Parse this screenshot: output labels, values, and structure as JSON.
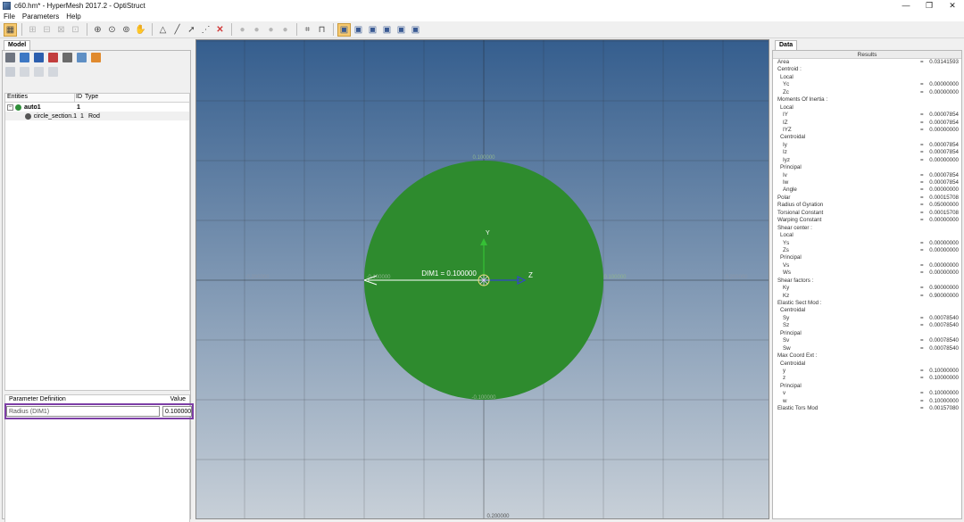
{
  "window": {
    "title": "c60.hm* - HyperMesh 2017.2 - OptiStruct",
    "controls": {
      "minimize": "—",
      "restore": "❐",
      "close": "✕"
    }
  },
  "menu": {
    "items": [
      "File",
      "Parameters",
      "Help"
    ]
  },
  "toolbar": {
    "groups": [
      [
        "grid-icon"
      ],
      [
        "node-add-icon",
        "line-icon",
        "surface-icon",
        "solid-icon"
      ],
      [
        "zoom-in-icon",
        "zoom-window-icon",
        "zoom-fit-icon",
        "pan-icon"
      ],
      [
        "polyline-icon",
        "line-draw-icon",
        "select-arrow-icon",
        "point-icon",
        "delete-icon"
      ],
      [
        "circle-1-icon",
        "circle-2-icon",
        "circle-3-icon",
        "circle-4-icon"
      ],
      [
        "hatch-icon",
        "section-icon"
      ],
      [
        "view-1-icon",
        "view-2-icon",
        "view-3-icon",
        "view-4-icon",
        "view-5-icon",
        "view-6-icon"
      ]
    ]
  },
  "left_panel": {
    "tab": "Model",
    "entities": {
      "headers": [
        "Entities",
        "ID",
        "Type"
      ],
      "rows": [
        {
          "name": "auto1",
          "id": "1",
          "type": ""
        },
        {
          "name": "circle_section.1",
          "id": "1",
          "type": "Rod"
        }
      ]
    },
    "parameters": {
      "header_label": "Parameter Definition",
      "header_value": "Value",
      "label": "Radius (DIM1)",
      "value": "0.100000"
    }
  },
  "viewport": {
    "colors": {
      "bg_top": "#355e8e",
      "bg_bottom": "#c8d0d8",
      "circle": "#2e8b2e",
      "axis": "#35c035",
      "z_axis": "#3344cc"
    },
    "tick_labels": {
      "top": "0.100000",
      "bottom_inner": "-0.100000",
      "left_outer": "-0.200000",
      "left_inner": "-0.100000",
      "right_inner": "0.100000",
      "right_outer": "0.200000",
      "bottom_outer": "0.200000"
    },
    "dim_label": "DIM1 = 0.100000",
    "y_label": "Y",
    "z_label": "Z"
  },
  "right_panel": {
    "tab": "Data",
    "results_title": "Results",
    "rows": [
      {
        "label": "Area",
        "indent": 0,
        "value": "0.03141593"
      },
      {
        "label": "Centroid :",
        "indent": 0,
        "value": ""
      },
      {
        "label": "Local",
        "indent": 1,
        "value": ""
      },
      {
        "label": "Yc",
        "indent": 2,
        "value": "0.00000000"
      },
      {
        "label": "Zc",
        "indent": 2,
        "value": "0.00000000"
      },
      {
        "label": "Moments Of Inertia :",
        "indent": 0,
        "value": ""
      },
      {
        "label": "Local",
        "indent": 1,
        "value": ""
      },
      {
        "label": "IY",
        "indent": 2,
        "value": "0.00007854"
      },
      {
        "label": "IZ",
        "indent": 2,
        "value": "0.00007854"
      },
      {
        "label": "IYZ",
        "indent": 2,
        "value": "0.00000000"
      },
      {
        "label": "Centroidal",
        "indent": 1,
        "value": ""
      },
      {
        "label": "Iy",
        "indent": 2,
        "value": "0.00007854"
      },
      {
        "label": "Iz",
        "indent": 2,
        "value": "0.00007854"
      },
      {
        "label": "Iyz",
        "indent": 2,
        "value": "0.00000000"
      },
      {
        "label": "Principal",
        "indent": 1,
        "value": ""
      },
      {
        "label": "Iv",
        "indent": 2,
        "value": "0.00007854"
      },
      {
        "label": "Iw",
        "indent": 2,
        "value": "0.00007854"
      },
      {
        "label": "Angle",
        "indent": 2,
        "value": "0.00000000"
      },
      {
        "label": "Polar",
        "indent": 0,
        "value": "0.00015708"
      },
      {
        "label": "Radius of Gyration",
        "indent": 0,
        "value": "0.05000000"
      },
      {
        "label": "Torsional Constant",
        "indent": 0,
        "value": "0.00015708"
      },
      {
        "label": "Warping Constant",
        "indent": 0,
        "value": "0.00000000"
      },
      {
        "label": "Shear center :",
        "indent": 0,
        "value": ""
      },
      {
        "label": "Local",
        "indent": 1,
        "value": ""
      },
      {
        "label": "Ys",
        "indent": 2,
        "value": "0.00000000"
      },
      {
        "label": "Zs",
        "indent": 2,
        "value": "0.00000000"
      },
      {
        "label": "Principal",
        "indent": 1,
        "value": ""
      },
      {
        "label": "Vs",
        "indent": 2,
        "value": "0.00000000"
      },
      {
        "label": "Ws",
        "indent": 2,
        "value": "0.00000000"
      },
      {
        "label": "Shear factors :",
        "indent": 0,
        "value": ""
      },
      {
        "label": "Ky",
        "indent": 2,
        "value": "0.90000000"
      },
      {
        "label": "Kz",
        "indent": 2,
        "value": "0.90000000"
      },
      {
        "label": "Elastic Sect Mod :",
        "indent": 0,
        "value": ""
      },
      {
        "label": "Centroidal",
        "indent": 1,
        "value": ""
      },
      {
        "label": "Sy",
        "indent": 2,
        "value": "0.00078540"
      },
      {
        "label": "Sz",
        "indent": 2,
        "value": "0.00078540"
      },
      {
        "label": "Principal",
        "indent": 1,
        "value": ""
      },
      {
        "label": "Sv",
        "indent": 2,
        "value": "0.00078540"
      },
      {
        "label": "Sw",
        "indent": 2,
        "value": "0.00078540"
      },
      {
        "label": "Max Coord Ext :",
        "indent": 0,
        "value": ""
      },
      {
        "label": "Centroidal",
        "indent": 1,
        "value": ""
      },
      {
        "label": "y",
        "indent": 2,
        "value": "0.10000000"
      },
      {
        "label": "z",
        "indent": 2,
        "value": "0.10000000"
      },
      {
        "label": "Principal",
        "indent": 1,
        "value": ""
      },
      {
        "label": "v",
        "indent": 2,
        "value": "0.10000000"
      },
      {
        "label": "w",
        "indent": 2,
        "value": "0.10000000"
      },
      {
        "label": "Elastic Tors Mod",
        "indent": 0,
        "value": "0.00157080"
      }
    ]
  }
}
